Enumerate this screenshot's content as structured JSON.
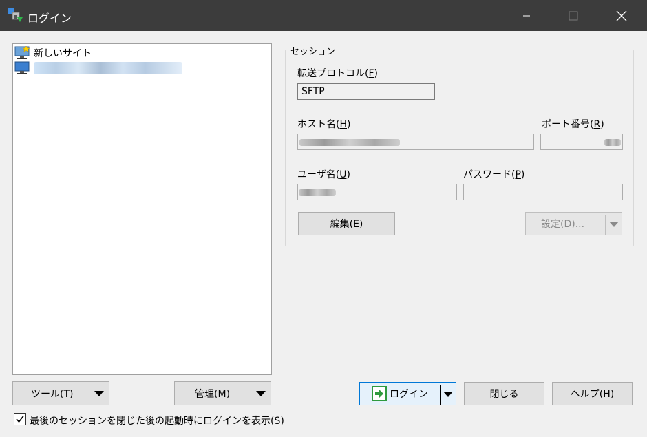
{
  "window": {
    "title": "ログイン",
    "icons": [
      "app-icon",
      "minimize-icon",
      "maximize-icon",
      "close-icon"
    ]
  },
  "sites": {
    "items": [
      {
        "label": "新しいサイト",
        "icon": "new-site-monitor-icon"
      },
      {
        "label": "",
        "icon": "site-monitor-icon",
        "note": "blurred"
      }
    ]
  },
  "session": {
    "group_label": "セッション",
    "protocol_label": "転送プロトコル(F)",
    "protocol_value": "SFTP",
    "host_label": "ホスト名(H)",
    "port_label": "ポート番号(R)",
    "user_label": "ユーザ名(U)",
    "password_label": "パスワード(P)",
    "edit_button": "編集(E)",
    "settings_button": "設定(D)..."
  },
  "bottom": {
    "tools_button": "ツール(T)",
    "manage_button": "管理(M)",
    "login_button": "ログイン",
    "close_button": "閉じる",
    "help_button": "ヘルプ(H)",
    "checkbox_label": "最後のセッションを閉じた後の起動時にログインを表示(S)",
    "checkbox_checked": true
  }
}
